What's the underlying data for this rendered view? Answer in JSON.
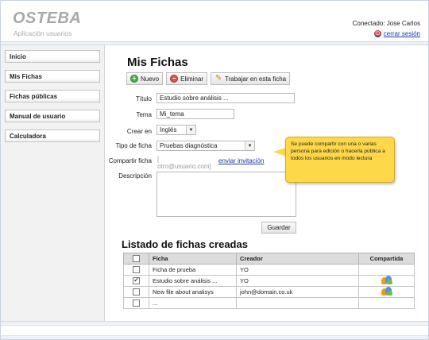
{
  "header": {
    "app_title": "OSTEBA",
    "app_subtitle": "Aplicación usuarios",
    "user_label": "Conectado:  Jose Carlos",
    "logout_label": "cerrar sesión"
  },
  "sidebar": {
    "items": [
      {
        "label": "Inicio"
      },
      {
        "label": "Mis Fichas"
      },
      {
        "label": "Fichas públicas"
      },
      {
        "label": "Manual de usuario"
      },
      {
        "label": "Calculadora"
      }
    ]
  },
  "main": {
    "title": "Mis Fichas",
    "toolbar": {
      "new_label": "Nuevo",
      "delete_label": "Eliminar",
      "work_label": "Trabajar en esta ficha"
    },
    "form": {
      "titulo_label": "Título",
      "titulo_value": "Estudio sobre análisis ...",
      "tema_label": "Tema",
      "tema_value": "Mi_tema",
      "crear_en_label": "Crear en",
      "crear_en_value": "Inglés",
      "tipo_label": "Tipo de ficha",
      "tipo_value": "Pruebas diagnóstica",
      "compartir_label": "Compartir ficha",
      "compartir_placeholder": "[ otro@usuario.com]",
      "invite_link": "enviar invitación",
      "descripcion_label": "Descripción",
      "save_label": "Guardar"
    },
    "tooltip": "Se puede compartir con una o varias persona para edición  o hacerla pública a todos los usuarios en modo lectura",
    "list": {
      "title": "Listado de fichas creadas",
      "columns": [
        "Ficha",
        "Creador",
        "Compartida"
      ],
      "rows": [
        {
          "checked": false,
          "ficha": "Ficha de prueba",
          "creador": "YO",
          "shared": false
        },
        {
          "checked": true,
          "ficha": "Estudio sobre análisis ...",
          "creador": "YO",
          "shared": true
        },
        {
          "checked": false,
          "ficha": "New file about analisys",
          "creador": "john@domain.co.uk",
          "shared": true
        },
        {
          "checked": false,
          "ficha": "...",
          "creador": "",
          "shared": false
        }
      ]
    }
  },
  "icons": {
    "new": "plus-circle-icon",
    "delete": "minus-circle-icon",
    "work": "pencil-icon",
    "shared": "users-icon",
    "logout": "logout-icon"
  },
  "colors": {
    "logo": "#a8a8a8",
    "link": "#1a3aa8",
    "tooltip_bg": "#ffd84a",
    "table_header_bg": "#dcdcdc"
  }
}
